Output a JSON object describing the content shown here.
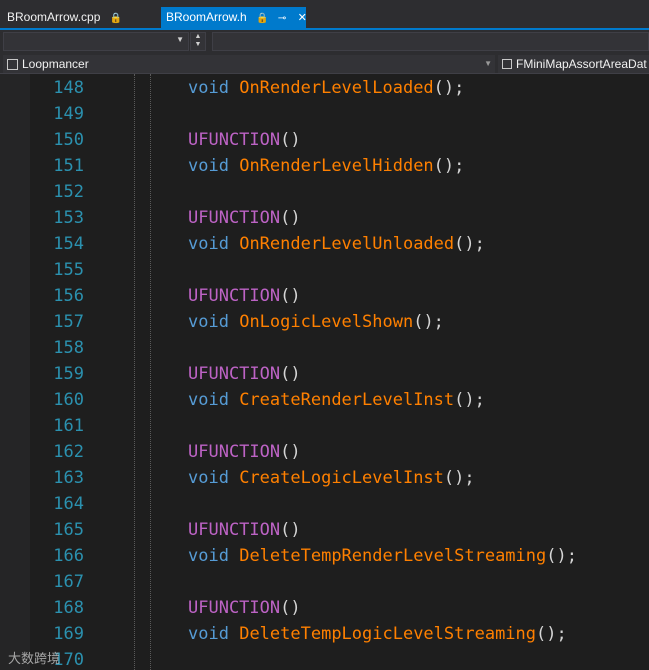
{
  "tabs": [
    {
      "label": "BRoomArrow.cpp",
      "active": false
    },
    {
      "label": "BRoomArrow.h",
      "active": true
    }
  ],
  "nav": {
    "project": "Loopmancer",
    "class_member": "FMiniMapAssortAreaDat"
  },
  "code_lines": [
    {
      "num": "148",
      "kind": "decl",
      "fn": "OnRenderLevelLoaded"
    },
    {
      "num": "149",
      "kind": "blank"
    },
    {
      "num": "150",
      "kind": "macro"
    },
    {
      "num": "151",
      "kind": "decl",
      "fn": "OnRenderLevelHidden"
    },
    {
      "num": "152",
      "kind": "blank"
    },
    {
      "num": "153",
      "kind": "macro"
    },
    {
      "num": "154",
      "kind": "decl",
      "fn": "OnRenderLevelUnloaded"
    },
    {
      "num": "155",
      "kind": "blank"
    },
    {
      "num": "156",
      "kind": "macro"
    },
    {
      "num": "157",
      "kind": "decl",
      "fn": "OnLogicLevelShown"
    },
    {
      "num": "158",
      "kind": "blank"
    },
    {
      "num": "159",
      "kind": "macro"
    },
    {
      "num": "160",
      "kind": "decl",
      "fn": "CreateRenderLevelInst"
    },
    {
      "num": "161",
      "kind": "blank"
    },
    {
      "num": "162",
      "kind": "macro"
    },
    {
      "num": "163",
      "kind": "decl",
      "fn": "CreateLogicLevelInst"
    },
    {
      "num": "164",
      "kind": "blank"
    },
    {
      "num": "165",
      "kind": "macro"
    },
    {
      "num": "166",
      "kind": "decl",
      "fn": "DeleteTempRenderLevelStreaming"
    },
    {
      "num": "167",
      "kind": "blank"
    },
    {
      "num": "168",
      "kind": "macro"
    },
    {
      "num": "169",
      "kind": "decl",
      "fn": "DeleteTempLogicLevelStreaming"
    },
    {
      "num": "170",
      "kind": "blank"
    }
  ],
  "tokens": {
    "void": "void",
    "macro": "UFUNCTION",
    "macro_tail": "()",
    "call_tail": "();"
  },
  "watermark": "大数跨境",
  "colors": {
    "background": "#1e1e1e",
    "line_number": "#2b91af",
    "keyword": "#569cd6",
    "macro": "#bd63c5",
    "function": "#ff8000",
    "punctuation": "#d4d4d4",
    "active_tab": "#007acc"
  },
  "icons": {
    "lock": "lock-icon",
    "pin": "pin-icon",
    "close": "close-icon",
    "project": "project-icon",
    "class": "class-icon"
  }
}
